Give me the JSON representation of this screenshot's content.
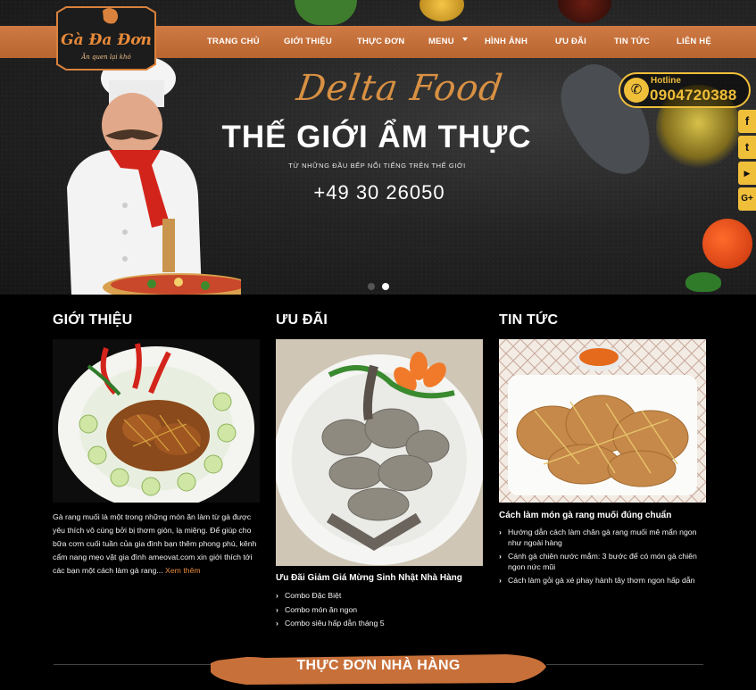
{
  "logo": {
    "text": "Gà Đa Đơn",
    "tagline": "Ăn quen lại khó"
  },
  "nav": {
    "items": [
      {
        "label": "TRANG CHỦ"
      },
      {
        "label": "GIỚI THIỆU"
      },
      {
        "label": "THỰC ĐƠN"
      },
      {
        "label": "MENU"
      },
      {
        "label": "HÌNH ẢNH"
      },
      {
        "label": "ƯU ĐÃI"
      },
      {
        "label": "TIN TỨC"
      },
      {
        "label": "LIÊN HỆ"
      }
    ]
  },
  "hero": {
    "script_title": "Delta Food",
    "title": "THẾ GIỚI ẨM THỰC",
    "subtitle": "TỪ NHỮNG ĐẦU BẾP NỔI TIẾNG TRÊN THẾ GIỚI",
    "phone": "+49 30 26050",
    "slide_count": 2,
    "active_slide": 2
  },
  "hotline": {
    "label": "Hotline",
    "number": "0904720388",
    "icon": "phone-icon",
    "color": "#f0bf3a"
  },
  "social": [
    {
      "icon": "facebook-icon",
      "glyph": "f"
    },
    {
      "icon": "twitter-icon",
      "glyph": "t"
    },
    {
      "icon": "youtube-icon",
      "glyph": "▶"
    },
    {
      "icon": "google-plus-icon",
      "glyph": "G+"
    }
  ],
  "sections": {
    "about": {
      "title": "GIỚI THIỆU",
      "text": "Gà rang muối là một trong những món ăn làm từ gà được yêu thích vô cùng bởi bị thơm giòn, lạ miệng. Để giúp cho bữa cơm cuối tuần của gia đình bạn thêm phong phú, kênh cẩm nang mẹo vặt gia đình ameovat.com xin giới thích tới các bạn một cách làm gà rang...",
      "more": "Xem thêm"
    },
    "promo": {
      "title": "ƯU ĐÃI",
      "headline": "Ưu Đãi Giảm Giá Mừng Sinh Nhật Nhà Hàng",
      "items": [
        "Combo Đặc Biệt",
        "Combo món ăn ngon",
        "Combo siêu hấp dẫn tháng 5"
      ]
    },
    "news": {
      "title": "TIN TỨC",
      "headline": "Cách làm món gà rang muối đúng chuẩn",
      "items": [
        "Hướng dẫn cách làm chân gà rang muối mê mẩn ngon như ngoài hàng",
        "Cánh gà chiên nước mắm: 3 bước để có món gà chiên ngon nức mũi",
        "Cách làm gỏi gà xé phay hành tây thơm ngon hấp dẫn"
      ]
    }
  },
  "menu_banner": {
    "title": "THỰC ĐƠN NHÀ HÀNG"
  },
  "colors": {
    "accent": "#c8703a",
    "gold": "#f0bf3a",
    "link": "#e88a3a",
    "background": "#000000"
  }
}
